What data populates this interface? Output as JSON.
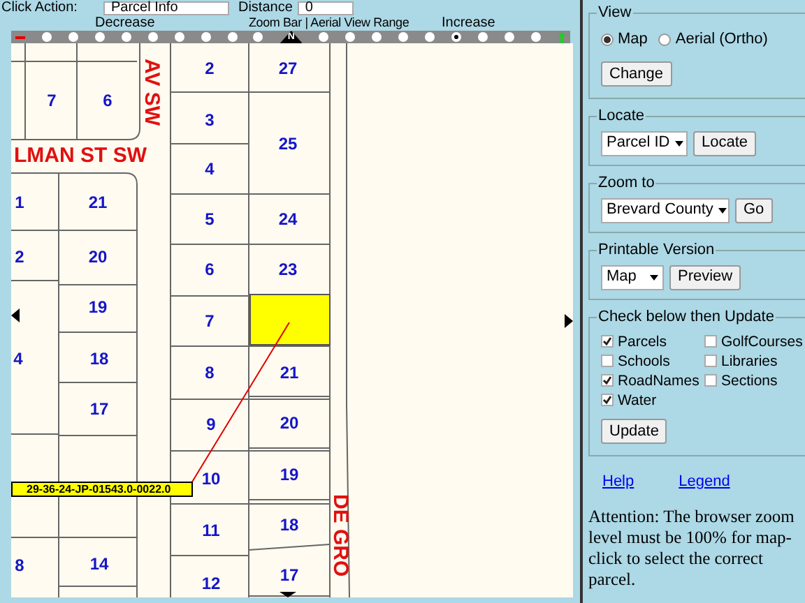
{
  "toolbar": {
    "action_label": "Click Action:",
    "action_value": "Parcel Info",
    "distance_label": "Distance",
    "distance_value": "0"
  },
  "zoom_bar": {
    "decrease_label": "Decrease",
    "title": "Zoom Bar | Aerial View Range",
    "increase_label": "Increase",
    "steps": [
      {
        "selected": false
      },
      {
        "selected": false
      },
      {
        "selected": false
      },
      {
        "selected": false
      },
      {
        "selected": false
      },
      {
        "selected": false
      },
      {
        "selected": false
      },
      {
        "selected": false
      },
      {
        "selected": false
      },
      {
        "selected": false,
        "label": "N"
      },
      {
        "selected": false
      },
      {
        "selected": false
      },
      {
        "selected": false
      },
      {
        "selected": false
      },
      {
        "selected": false
      },
      {
        "selected": true
      },
      {
        "selected": false
      },
      {
        "selected": false
      },
      {
        "selected": false
      }
    ]
  },
  "map": {
    "lots": [
      "7",
      "6",
      "1",
      "2",
      "4",
      "8",
      "21",
      "20",
      "19",
      "18",
      "17",
      "14",
      "2",
      "3",
      "4",
      "5",
      "6",
      "7",
      "8",
      "9",
      "10",
      "11",
      "12",
      "27",
      "25",
      "24",
      "23",
      "21",
      "20",
      "19",
      "18",
      "17"
    ],
    "streets": [
      {
        "text": "LMAN ST SW",
        "kind": "horizontal"
      },
      {
        "text": "AV SW",
        "kind": "vertical"
      },
      {
        "text": "DE GRO",
        "kind": "vertical"
      }
    ],
    "parcel_label": "29-36-24-JP-01543.0-0022.0"
  },
  "view": {
    "legend": "View",
    "options": [
      {
        "label": "Map",
        "selected": true
      },
      {
        "label": "Aerial (Ortho)",
        "selected": false
      }
    ],
    "button": "Change"
  },
  "locate": {
    "legend": "Locate",
    "select": "Parcel ID",
    "button": "Locate"
  },
  "zoom_to": {
    "legend": "Zoom to",
    "select": "Brevard County",
    "button": "Go"
  },
  "printable": {
    "legend": "Printable Version",
    "select": "Map",
    "button": "Preview"
  },
  "layers": {
    "legend": "Check below then Update",
    "items": [
      {
        "label": "Parcels",
        "checked": true
      },
      {
        "label": "GolfCourses",
        "checked": false
      },
      {
        "label": "Schools",
        "checked": false
      },
      {
        "label": "Libraries",
        "checked": false
      },
      {
        "label": "RoadNames",
        "checked": true
      },
      {
        "label": "Sections",
        "checked": false
      },
      {
        "label": "Water",
        "checked": true
      }
    ],
    "button": "Update"
  },
  "links": [
    "Help",
    "Legend"
  ],
  "notice": "Attention: The browser zoom level must be 100% for map-click to select the correct parcel."
}
